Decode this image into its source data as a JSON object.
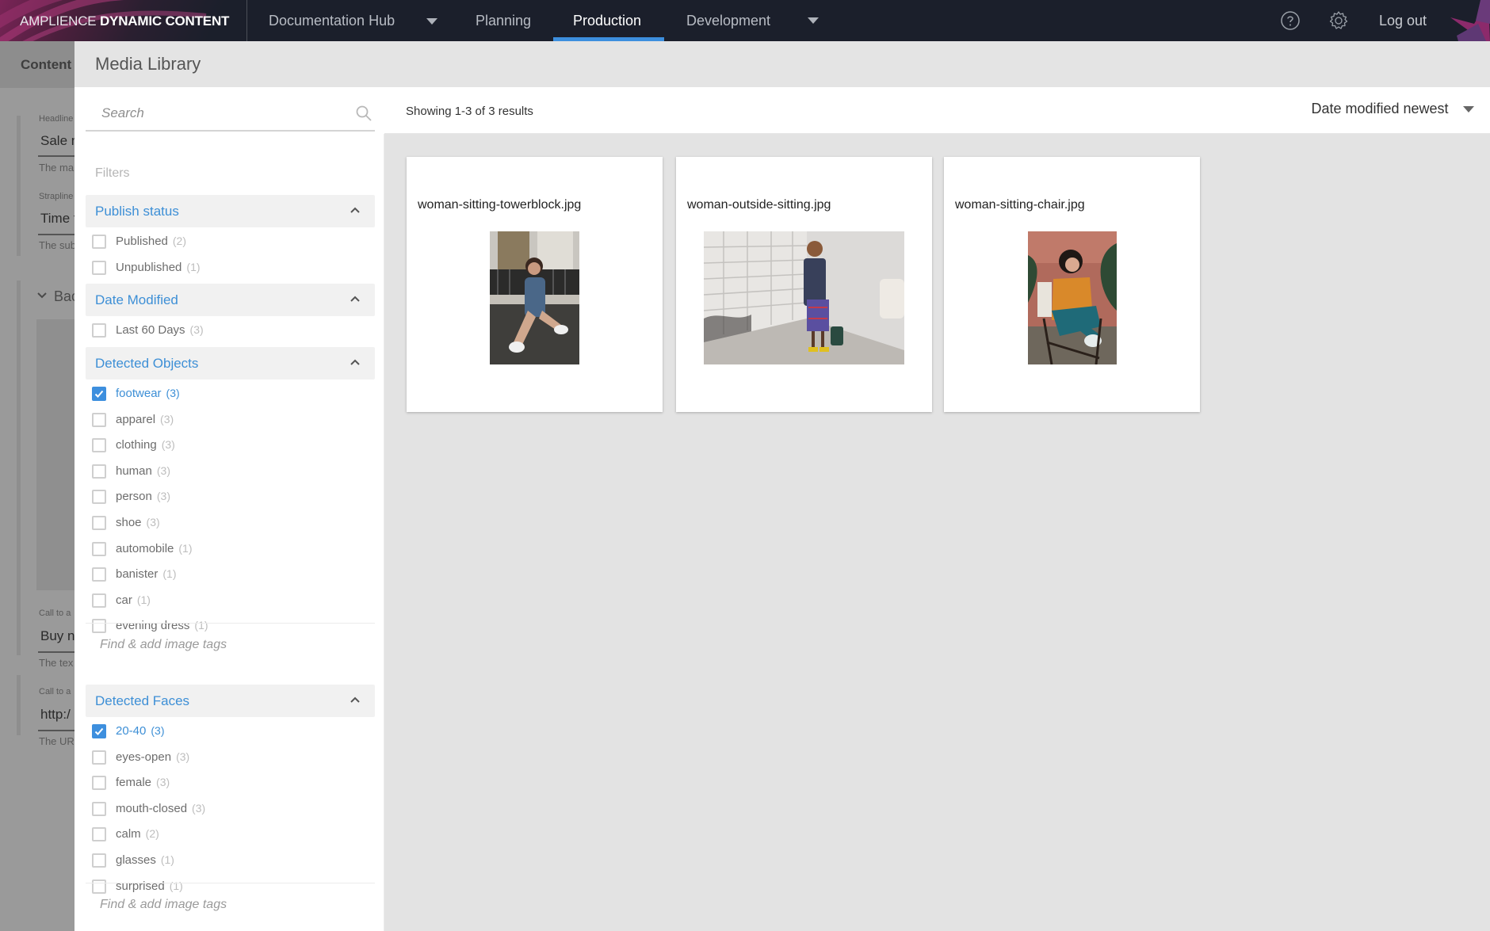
{
  "topbar": {
    "logo_light": "AMPLIENCE",
    "logo_bold": "DYNAMIC CONTENT",
    "hub": "Documentation Hub",
    "tabs": [
      {
        "label": "Planning",
        "active": false
      },
      {
        "label": "Production",
        "active": true
      },
      {
        "label": "Development",
        "active": false
      }
    ],
    "help_icon": "help-circle-icon",
    "settings_icon": "gear-icon",
    "logout": "Log out",
    "accent": "#3d8fde"
  },
  "background_page": {
    "header": "Content I",
    "fields": [
      {
        "label": "Headline",
        "value": "Sale n",
        "help": "The ma"
      },
      {
        "label": "Strapline",
        "value": "Time t",
        "help": "The sub"
      },
      {
        "label": "Call to a",
        "value": "Buy no",
        "help": "The tex"
      },
      {
        "label": "Call to a",
        "value": "http:/",
        "help": "The UR"
      }
    ],
    "section": "Bac"
  },
  "media_library": {
    "title": "Media Library",
    "search_placeholder": "Search",
    "filters_label": "Filters",
    "groups": [
      {
        "title": "Publish status",
        "options": [
          {
            "label": "Published",
            "count": "(2)",
            "checked": false
          },
          {
            "label": "Unpublished",
            "count": "(1)",
            "checked": false
          }
        ]
      },
      {
        "title": "Date Modified",
        "options": [
          {
            "label": "Last 60 Days",
            "count": "(3)",
            "checked": false
          }
        ]
      },
      {
        "title": "Detected Objects",
        "options": [
          {
            "label": "footwear",
            "count": "(3)",
            "checked": true
          },
          {
            "label": "apparel",
            "count": "(3)",
            "checked": false
          },
          {
            "label": "clothing",
            "count": "(3)",
            "checked": false
          },
          {
            "label": "human",
            "count": "(3)",
            "checked": false
          },
          {
            "label": "person",
            "count": "(3)",
            "checked": false
          },
          {
            "label": "shoe",
            "count": "(3)",
            "checked": false
          },
          {
            "label": "automobile",
            "count": "(1)",
            "checked": false
          },
          {
            "label": "banister",
            "count": "(1)",
            "checked": false
          },
          {
            "label": "car",
            "count": "(1)",
            "checked": false
          },
          {
            "label": "evening dress",
            "count": "(1)",
            "checked": false
          }
        ],
        "tag_placeholder": "Find & add image tags"
      },
      {
        "title": "Detected Faces",
        "options": [
          {
            "label": "20-40",
            "count": "(3)",
            "checked": true
          },
          {
            "label": "eyes-open",
            "count": "(3)",
            "checked": false
          },
          {
            "label": "female",
            "count": "(3)",
            "checked": false
          },
          {
            "label": "mouth-closed",
            "count": "(3)",
            "checked": false
          },
          {
            "label": "calm",
            "count": "(2)",
            "checked": false
          },
          {
            "label": "glasses",
            "count": "(1)",
            "checked": false
          },
          {
            "label": "surprised",
            "count": "(1)",
            "checked": false
          }
        ],
        "tag_placeholder": "Find & add image tags"
      }
    ],
    "results_count": "Showing 1-3 of 3 results",
    "sort": "Date modified newest",
    "assets": [
      {
        "name": "woman-sitting-towerblock.jpg",
        "thumb": "portrait-towerblock"
      },
      {
        "name": "woman-outside-sitting.jpg",
        "thumb": "landscape-wall"
      },
      {
        "name": "woman-sitting-chair.jpg",
        "thumb": "portrait-chair"
      }
    ]
  }
}
